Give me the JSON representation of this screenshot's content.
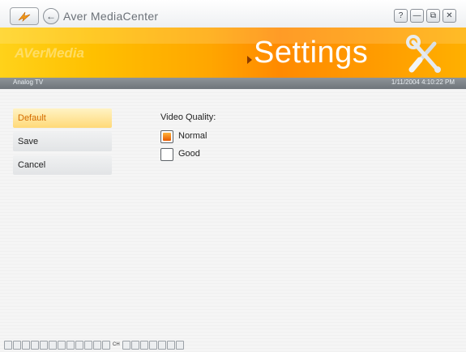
{
  "titlebar": {
    "app_title": "Aver MediaCenter",
    "window_buttons": [
      {
        "name": "help-button",
        "label": "?"
      },
      {
        "name": "minimize-button",
        "label": "—"
      },
      {
        "name": "restore-button",
        "label": "⧉"
      },
      {
        "name": "close-button",
        "label": "✕"
      }
    ]
  },
  "banner": {
    "brand": "AVerMedia",
    "title": "Settings",
    "icon": "tools-icon"
  },
  "subbar": {
    "mode": "Analog TV",
    "datetime": "1/11/2004 4:10:22 PM"
  },
  "menu": {
    "items": [
      {
        "label": "Default",
        "active": true
      },
      {
        "label": "Save",
        "active": false
      },
      {
        "label": "Cancel",
        "active": false
      }
    ]
  },
  "video_quality": {
    "title": "Video Quality:",
    "options": [
      {
        "label": "Normal",
        "selected": true
      },
      {
        "label": "Good",
        "selected": false
      }
    ]
  },
  "bottom_bar": {
    "channel_label": "CH"
  },
  "colors": {
    "accent_orange": "#ff9a00",
    "active_text": "#d46c00",
    "subbar_grey": "#7d8388"
  }
}
